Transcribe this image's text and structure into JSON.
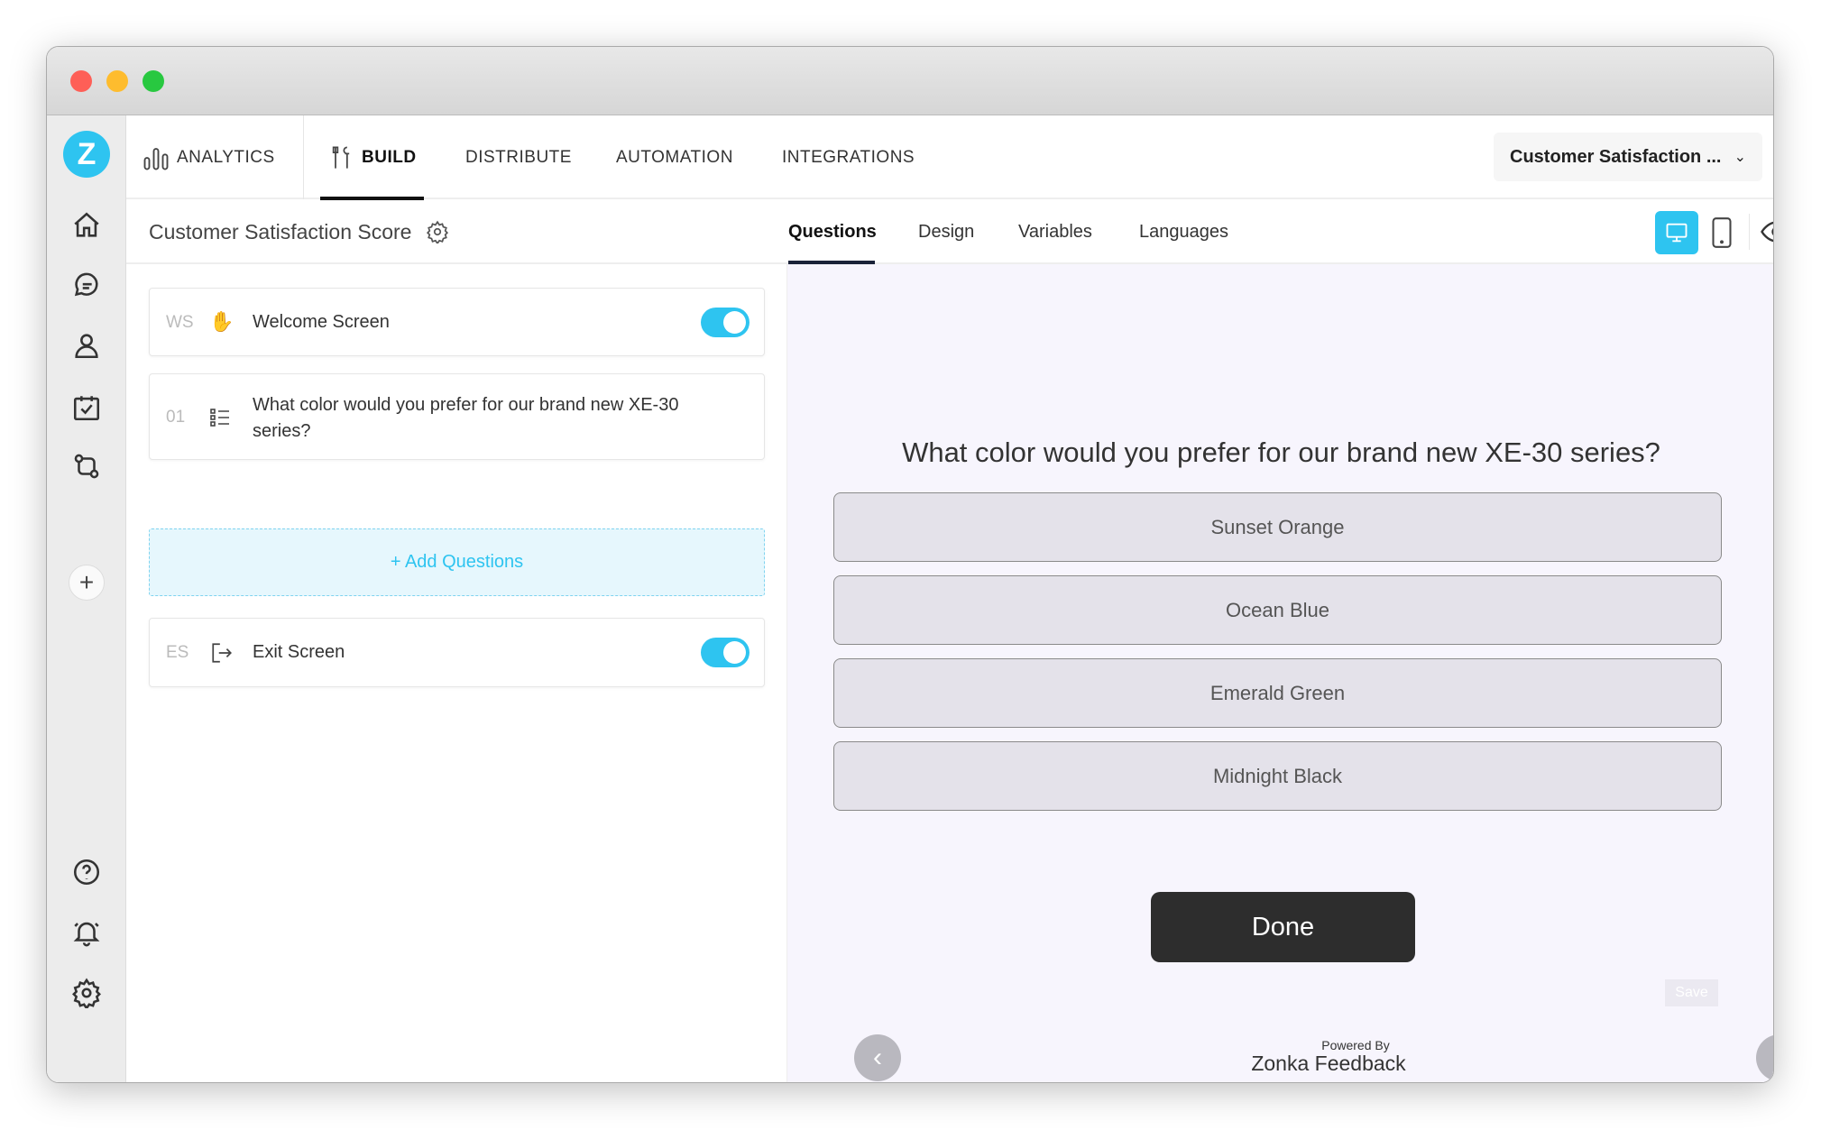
{
  "nav": {
    "items": [
      {
        "label": "ANALYTICS",
        "icon": "analytics-icon"
      },
      {
        "label": "BUILD",
        "icon": "build-icon",
        "active": true
      },
      {
        "label": "DISTRIBUTE"
      },
      {
        "label": "AUTOMATION"
      },
      {
        "label": "INTEGRATIONS"
      }
    ],
    "survey_select": "Customer Satisfaction ..."
  },
  "subheader": {
    "title": "Customer Satisfaction Score",
    "tabs": [
      "Questions",
      "Design",
      "Variables",
      "Languages"
    ],
    "active_tab": "Questions"
  },
  "questions": {
    "welcome": {
      "code": "WS",
      "label": "Welcome Screen",
      "enabled": true
    },
    "items": [
      {
        "code": "01",
        "label": "What color would you prefer for our brand new XE-30 series?"
      }
    ],
    "add_label": "+ Add Questions",
    "exit": {
      "code": "ES",
      "label": "Exit Screen",
      "enabled": true
    }
  },
  "preview": {
    "question": "What color would you prefer for our brand new XE-30 series?",
    "options": [
      "Sunset Orange",
      "Ocean Blue",
      "Emerald Green",
      "Midnight Black"
    ],
    "done_label": "Done",
    "save_label": "Save",
    "powered_by": "Powered By",
    "brand": "Zonka Feedback"
  },
  "colors": {
    "accent": "#2ec4f0",
    "preview_bg": "#f7f5fd",
    "done_bg": "#2d2d2d"
  }
}
